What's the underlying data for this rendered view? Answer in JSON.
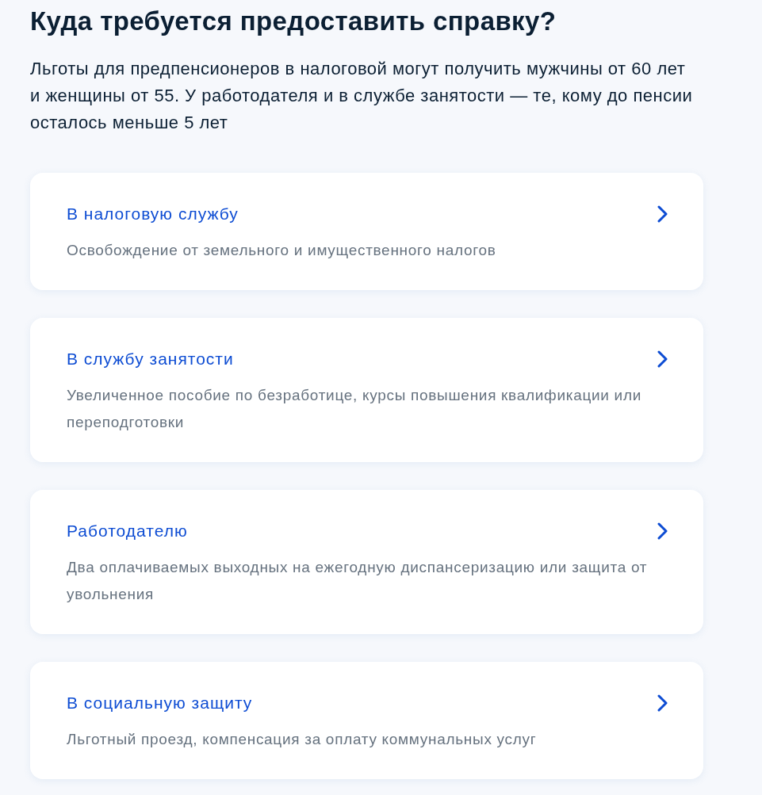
{
  "heading": "Куда требуется предоставить справку?",
  "intro": "Льготы для предпенсионеров в налоговой могут получить мужчины от 60 лет и женщины от 55. У работодателя и в службе занятости — те, кому до пенсии осталось меньше 5 лет",
  "options": [
    {
      "title": "В налоговую службу",
      "description": "Освобождение от земельного и имущественного налогов"
    },
    {
      "title": "В службу занятости",
      "description": "Увеличенное пособие по безработице, курсы повышения квалификации или переподготовки"
    },
    {
      "title": "Работодателю",
      "description": "Два оплачиваемых выходных на ежегодную диспансеризацию или защита от увольнения"
    },
    {
      "title": "В социальную защиту",
      "description": "Льготный проезд, компенсация за оплату коммунальных услуг"
    }
  ]
}
